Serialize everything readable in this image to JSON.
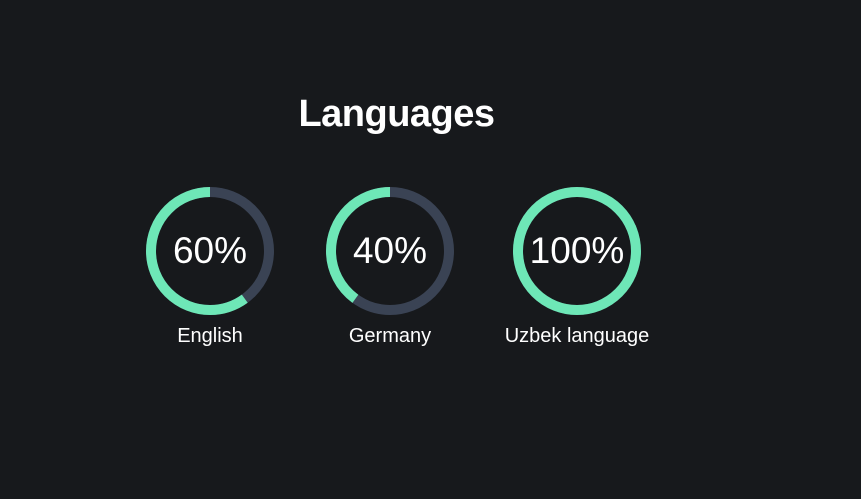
{
  "page": {
    "title": "Languages"
  },
  "colors": {
    "background": "#17191c",
    "progress": "#6ee7b7",
    "track": "#3a4354",
    "text": "#ffffff"
  },
  "skills": [
    {
      "label": "English",
      "percent_text": "60%",
      "value": 0.6
    },
    {
      "label": "Germany",
      "percent_text": "40%",
      "value": 0.4
    },
    {
      "label": "Uzbek language",
      "percent_text": "100%",
      "value": 1.0
    }
  ]
}
